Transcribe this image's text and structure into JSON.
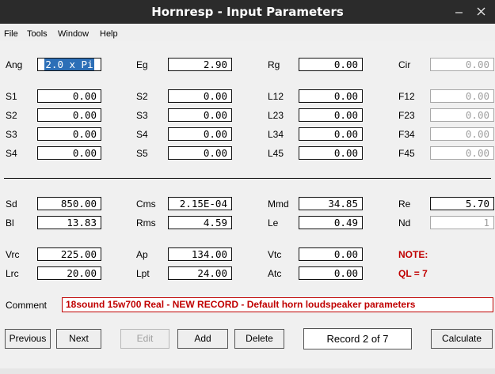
{
  "window": {
    "title": "Hornresp - Input Parameters"
  },
  "menu": [
    "File",
    "Tools",
    "Window",
    "Help"
  ],
  "horn": [
    {
      "label": "Ang",
      "value": "2.0 x Pi",
      "selected": true
    },
    {
      "label": "Eg",
      "value": "2.90"
    },
    {
      "label": "Rg",
      "value": "0.00"
    },
    {
      "label": "Cir",
      "value": "0.00",
      "disabled": true
    },
    {
      "label": "S1",
      "value": "0.00"
    },
    {
      "label": "S2",
      "value": "0.00"
    },
    {
      "label": "L12",
      "value": "0.00"
    },
    {
      "label": "F12",
      "value": "0.00",
      "disabled": true
    },
    {
      "label": "S2",
      "value": "0.00"
    },
    {
      "label": "S3",
      "value": "0.00"
    },
    {
      "label": "L23",
      "value": "0.00"
    },
    {
      "label": "F23",
      "value": "0.00",
      "disabled": true
    },
    {
      "label": "S3",
      "value": "0.00"
    },
    {
      "label": "S4",
      "value": "0.00"
    },
    {
      "label": "L34",
      "value": "0.00"
    },
    {
      "label": "F34",
      "value": "0.00",
      "disabled": true
    },
    {
      "label": "S4",
      "value": "0.00"
    },
    {
      "label": "S5",
      "value": "0.00"
    },
    {
      "label": "L45",
      "value": "0.00"
    },
    {
      "label": "F45",
      "value": "0.00",
      "disabled": true
    }
  ],
  "driver": [
    {
      "label": "Sd",
      "value": "850.00"
    },
    {
      "label": "Cms",
      "value": "2.15E-04"
    },
    {
      "label": "Mmd",
      "value": "34.85"
    },
    {
      "label": "Re",
      "value": "5.70"
    },
    {
      "label": "Bl",
      "value": "13.83"
    },
    {
      "label": "Rms",
      "value": "4.59"
    },
    {
      "label": "Le",
      "value": "0.49"
    },
    {
      "label": "Nd",
      "value": "1",
      "disabled": true
    },
    {
      "label": "Vrc",
      "value": "225.00"
    },
    {
      "label": "Ap",
      "value": "134.00"
    },
    {
      "label": "Vtc",
      "value": "0.00"
    },
    {
      "label": "Lrc",
      "value": "20.00"
    },
    {
      "label": "Lpt",
      "value": "24.00"
    },
    {
      "label": "Atc",
      "value": "0.00"
    }
  ],
  "note": {
    "label": "NOTE:",
    "text": "QL = 7"
  },
  "comment": {
    "label": "Comment",
    "value": "18sound 15w700 Real - NEW RECORD - Default horn loudspeaker parameters"
  },
  "buttons": [
    {
      "label": "Previous"
    },
    {
      "label": "Next"
    },
    {
      "label": "Edit",
      "disabled": true
    },
    {
      "label": "Add"
    },
    {
      "label": "Delete"
    },
    {
      "label": "Calculate"
    }
  ],
  "record": "Record 2 of 7"
}
